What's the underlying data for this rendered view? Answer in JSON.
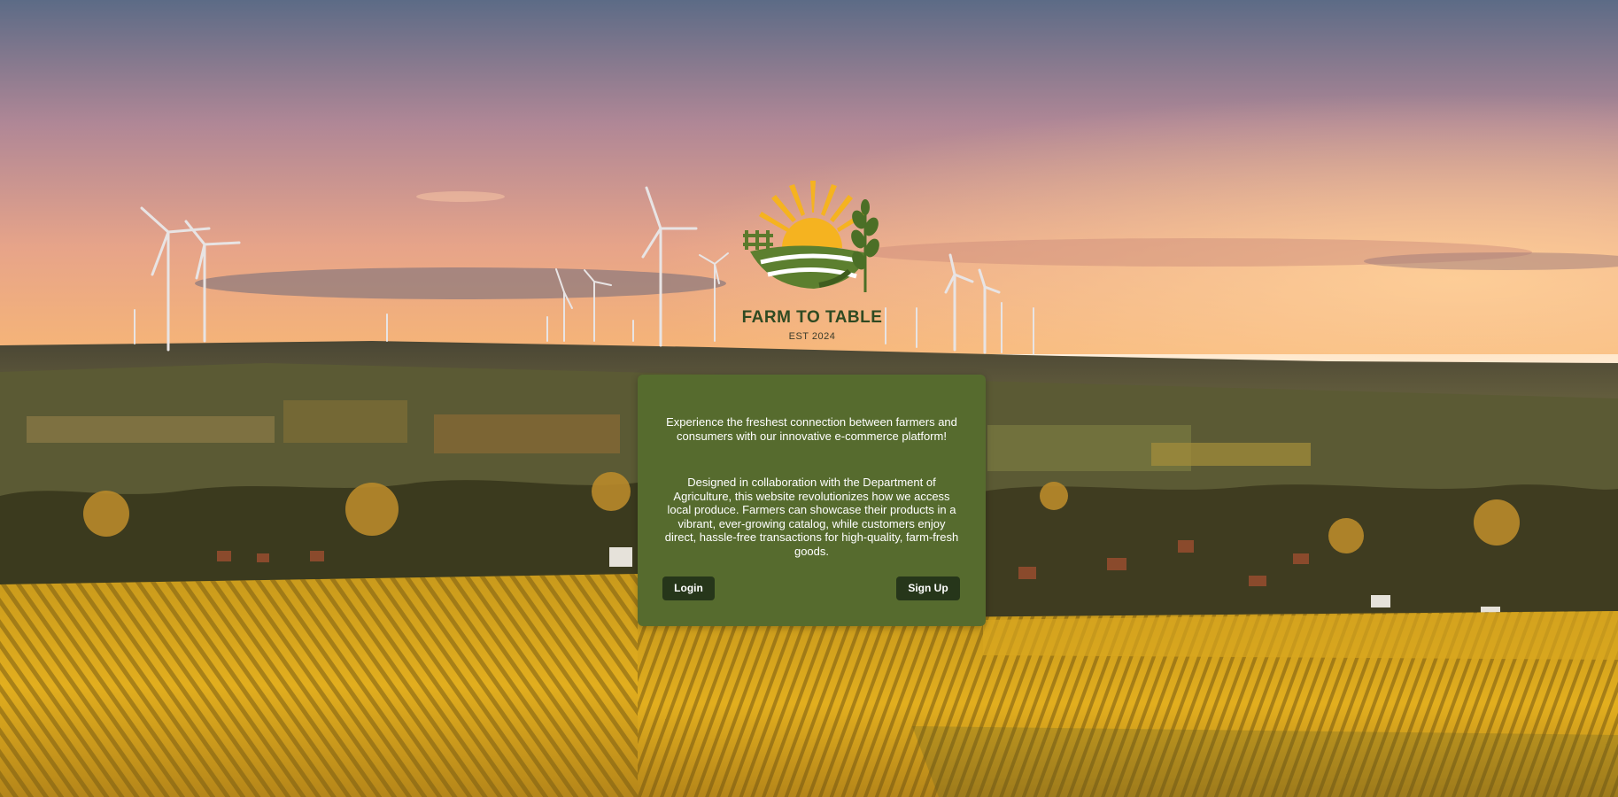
{
  "brand": {
    "name": "FARM TO TABLE",
    "established": "EST 2024"
  },
  "intro": {
    "paragraph1": "Experience the freshest connection between farmers and consumers with our innovative e-commerce platform!",
    "paragraph2": "Designed in collaboration with the Department of Agriculture, this website revolutionizes how we access local produce. Farmers can showcase their products in a vibrant, ever-growing catalog, while customers enjoy direct, hassle-free transactions for high-quality, farm-fresh goods."
  },
  "actions": {
    "login_label": "Login",
    "signup_label": "Sign Up"
  },
  "colors": {
    "card_background": "#566b2e",
    "button_background": "#26361a",
    "logo_text": "#2f4a22",
    "sun": "#f5b320"
  },
  "icons": {
    "logo": "sun-over-fields-logo"
  }
}
